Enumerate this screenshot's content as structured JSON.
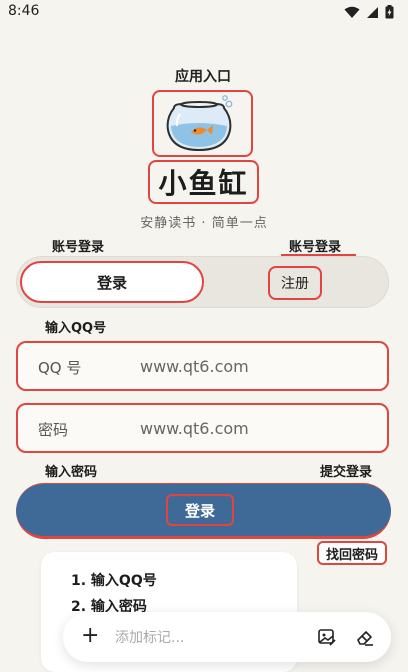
{
  "status_bar": {
    "time": "8:46"
  },
  "header": {
    "entry_caption": "应用入口",
    "app_title": "小鱼缸",
    "slogan": "安静读书 · 简单一点"
  },
  "annotations": {
    "account_login_left": "账号登录",
    "account_login_right": "账号登录",
    "input_qq": "输入QQ号",
    "input_password": "输入密码",
    "submit_login": "提交登录"
  },
  "tabs": {
    "login": "登录",
    "register": "注册"
  },
  "form": {
    "qq_label": "QQ 号",
    "qq_placeholder": "www.qt6.com",
    "password_label": "密码",
    "password_placeholder": "www.qt6.com"
  },
  "login_button": "登录",
  "forgot_password": "找回密码",
  "steps": [
    "1. 输入QQ号",
    "2. 输入密码"
  ],
  "annotation_bar": {
    "placeholder": "添加标记..."
  },
  "colors": {
    "accent_red": "#e0453f",
    "button_blue": "#3f6a98",
    "background": "#f6f4ef"
  }
}
